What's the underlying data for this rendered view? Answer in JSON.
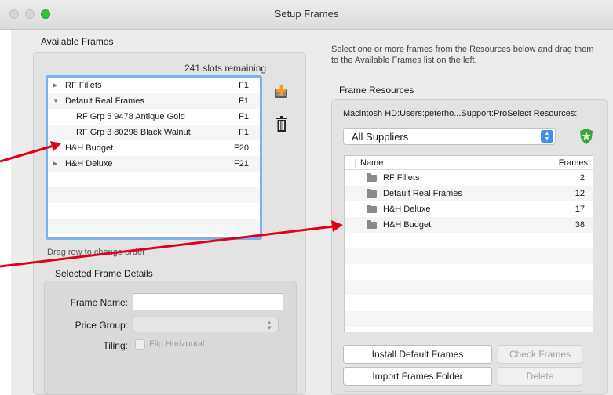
{
  "window": {
    "title": "Setup Frames"
  },
  "available": {
    "title": "Available Frames",
    "slots": "241 slots remaining",
    "rows": [
      {
        "name": "RF Fillets",
        "code": "F1",
        "toggle": "▶"
      },
      {
        "name": "Default Real Frames",
        "code": "F1",
        "toggle": "▼"
      },
      {
        "name": "RF Grp 5  9478 Antique Gold",
        "code": "F1",
        "toggle": ""
      },
      {
        "name": "RF Grp 3  80298 Black Walnut",
        "code": "F1",
        "toggle": ""
      },
      {
        "name": "H&H Budget",
        "code": "F20",
        "toggle": "▶"
      },
      {
        "name": "H&H Deluxe",
        "code": "F21",
        "toggle": "▶"
      }
    ],
    "drag_hint": "Drag row to change order"
  },
  "details": {
    "title": "Selected Frame Details",
    "frame_name_label": "Frame Name:",
    "frame_name_value": "",
    "price_group_label": "Price Group:",
    "price_group_value": "",
    "tiling_label": "Tiling:",
    "flip_label": "Flip Horizontal"
  },
  "resources": {
    "instructions": "Select one or more frames from the Resources below and drag them to the Available Frames list on the left.",
    "title": "Frame Resources",
    "path": "Macintosh HD:Users:peterho...Support:ProSelect Resources:",
    "supplier": "All Suppliers",
    "col_name": "Name",
    "col_frames": "Frames",
    "rows": [
      {
        "name": "RF Fillets",
        "frames": "2"
      },
      {
        "name": "Default Real Frames",
        "frames": "12"
      },
      {
        "name": "H&H Deluxe",
        "frames": "17"
      },
      {
        "name": "H&H Budget",
        "frames": "38"
      }
    ]
  },
  "buttons": {
    "install": "Install Default Frames",
    "check": "Check Frames",
    "import": "Import Frames Folder",
    "delete": "Delete"
  },
  "colors": {
    "annotation_arrow": "#e0001b",
    "select_blue": "#3d8ef7",
    "list_focus": "#7fb0e6",
    "shield_green": "#3aa63a"
  },
  "icons": {
    "add": "add-frame-icon",
    "trash": "trash-icon",
    "shield": "shield-icon",
    "folder": "folder-icon"
  }
}
